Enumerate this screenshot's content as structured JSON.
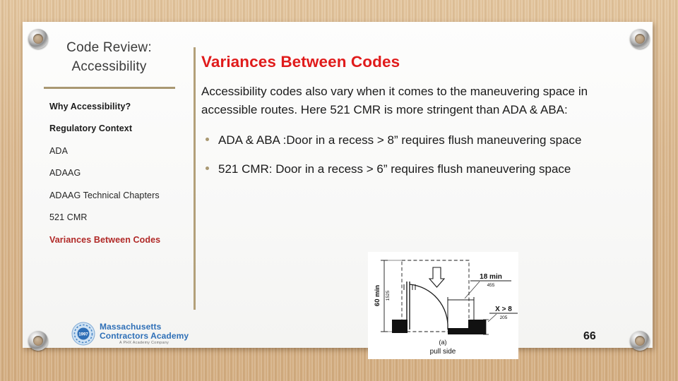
{
  "slide": {
    "page_number": "66",
    "background_color": "#d6b486",
    "paper_color": "#fbfbfa",
    "accent_rule_color": "#a99872",
    "heading_red": "#e01b1b",
    "toc_active_red": "#b02826",
    "logo_blue": "#2e6fb7"
  },
  "sidebar": {
    "deck_title": "Code Review:\nAccessibility",
    "deck_title_line1": "Code Review:",
    "deck_title_line2": "Accessibility",
    "items": [
      {
        "label": "Why Accessibility?",
        "style": "bold",
        "active": false
      },
      {
        "label": "Regulatory Context",
        "style": "bold",
        "active": false
      },
      {
        "label": "ADA",
        "style": "plain",
        "active": false
      },
      {
        "label": "ADAAG",
        "style": "plain",
        "active": false
      },
      {
        "label": "ADAAG Technical Chapters",
        "style": "plain",
        "active": false
      },
      {
        "label": "521 CMR",
        "style": "plain",
        "active": false
      },
      {
        "label": "Variances Between Codes",
        "style": "bold",
        "active": true
      }
    ]
  },
  "content": {
    "heading": "Variances Between Codes",
    "intro": "Accessibility codes also vary when it comes to the maneuvering space in accessible routes. Here 521 CMR is more stringent than ADA & ABA:",
    "bullets": [
      "ADA & ABA :Door in a recess > 8” requires flush maneuvering space",
      "521 CMR: Door in a recess > 6” requires flush maneuvering space"
    ]
  },
  "diagram": {
    "caption_letter": "(a)",
    "caption_text": "pull side",
    "labels": {
      "vertical_dim": "60 min",
      "vertical_dim_metric": "1525",
      "top_dim": "18 min",
      "top_dim_metric": "455",
      "recess_dim": "X > 8",
      "recess_dim_metric": "205"
    }
  },
  "logo": {
    "line1": "Massachusetts",
    "line2": "Contractors Academy",
    "tagline": "A PHX Academy Company",
    "seal_year": "1997"
  }
}
